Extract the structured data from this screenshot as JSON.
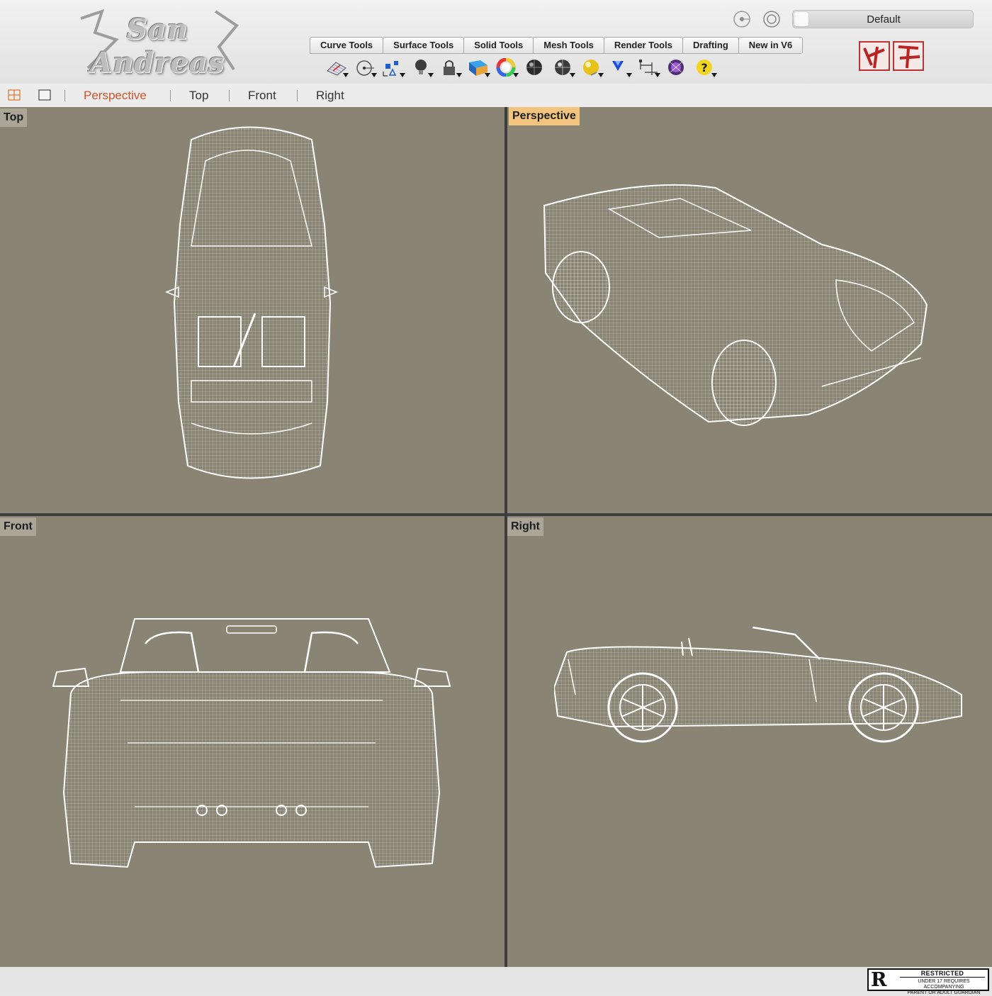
{
  "header": {
    "logo_text": "San Andreas",
    "tabs": [
      "Curve Tools",
      "Surface Tools",
      "Solid Tools",
      "Mesh Tools",
      "Render Tools",
      "Drafting",
      "New in V6"
    ],
    "preset_value": "Default",
    "toolbar_icons": [
      "construction-plane-icon",
      "circle-point-icon",
      "transform-points-icon",
      "light-bulb-icon",
      "lock-icon",
      "surface-icon",
      "color-wheel-icon",
      "sphere-shaded-icon",
      "sphere-ghosted-icon",
      "render-sphere-icon",
      "select-filter-icon",
      "dimension-icon",
      "environment-icon",
      "help-icon"
    ]
  },
  "viewbar": {
    "tabs": [
      "Perspective",
      "Top",
      "Front",
      "Right"
    ],
    "active_tab": "Perspective"
  },
  "viewports": {
    "top_label": "Top",
    "perspective_label": "Perspective",
    "front_label": "Front",
    "right_label": "Right",
    "active": "Perspective"
  },
  "rating": {
    "letter": "R",
    "heading": "RESTRICTED",
    "line1": "UNDER 17 REQUIRES ACCOMPANYING",
    "line2": "PARENT OR ADULT GUARDIAN"
  },
  "colors": {
    "viewport_bg": "#8a8474",
    "active_label_bg": "#f2c47e",
    "active_tab_text": "#d0542c",
    "wireframe": "#ffffff"
  }
}
